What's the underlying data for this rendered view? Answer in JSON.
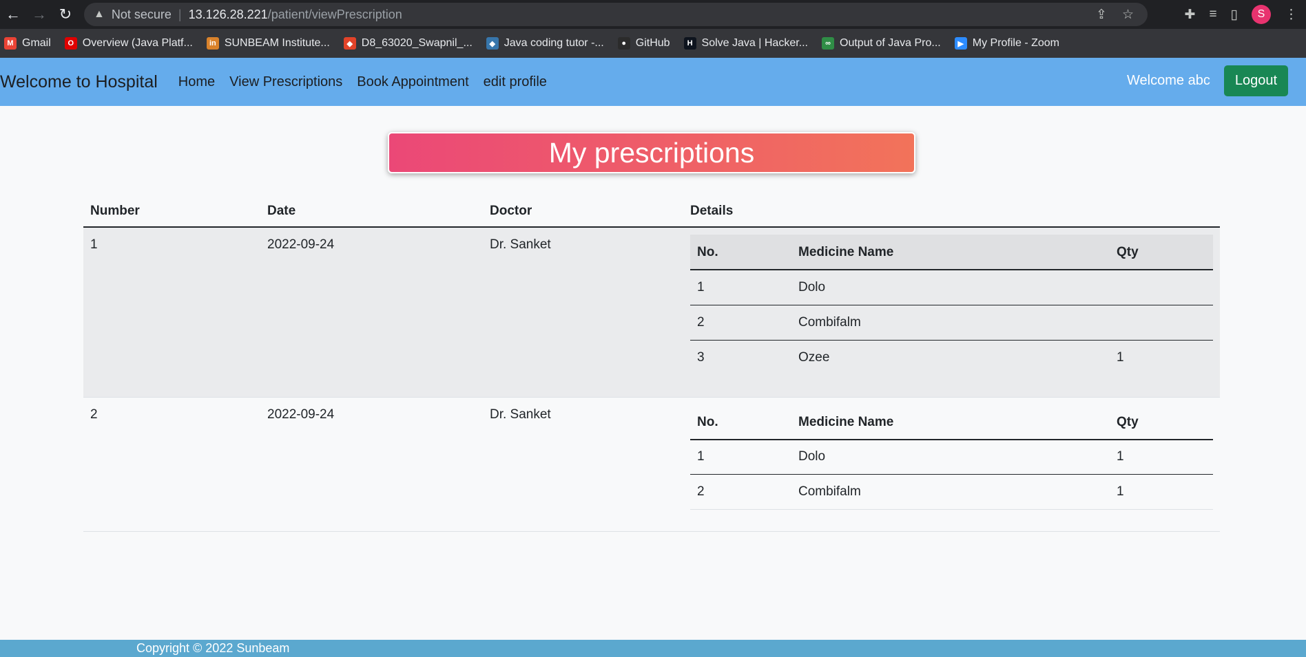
{
  "browser": {
    "security": "Not secure",
    "url_host": "13.126.28.221",
    "url_path": "/patient/viewPrescription",
    "profile_initial": "S",
    "bookmarks": [
      {
        "label": "Gmail",
        "color": "#ea4335",
        "glyph": "M"
      },
      {
        "label": "Overview (Java Platf...",
        "color": "#e00000",
        "glyph": "O"
      },
      {
        "label": "SUNBEAM Institute...",
        "color": "#d9822b",
        "glyph": "in"
      },
      {
        "label": "D8_63020_Swapnil_...",
        "color": "#e24329",
        "glyph": "◆"
      },
      {
        "label": "Java coding tutor -...",
        "color": "#3776ab",
        "glyph": "◆"
      },
      {
        "label": "GitHub",
        "color": "#2b2b2b",
        "glyph": "●"
      },
      {
        "label": "Solve Java | Hacker...",
        "color": "#0e141e",
        "glyph": "H"
      },
      {
        "label": "Output of Java Pro...",
        "color": "#2f8d46",
        "glyph": "∞"
      },
      {
        "label": "My Profile - Zoom",
        "color": "#2d8cff",
        "glyph": "▶"
      }
    ]
  },
  "navbar": {
    "brand": "Welcome to Hospital",
    "links": [
      "Home",
      "View Prescriptions",
      "Book Appointment",
      "edit profile"
    ],
    "welcome": "Welcome abc",
    "logout": "Logout"
  },
  "page": {
    "title": "My prescriptions"
  },
  "table": {
    "headers": [
      "Number",
      "Date",
      "Doctor",
      "Details"
    ],
    "inner_headers": [
      "No.",
      "Medicine Name",
      "Qty"
    ],
    "rows": [
      {
        "number": "1",
        "date": "2022-09-24",
        "doctor": "Dr. Sanket",
        "medicines": [
          {
            "no": "1",
            "name": "Dolo",
            "qty": ""
          },
          {
            "no": "2",
            "name": "Combifalm",
            "qty": ""
          },
          {
            "no": "3",
            "name": "Ozee",
            "qty": "1"
          }
        ]
      },
      {
        "number": "2",
        "date": "2022-09-24",
        "doctor": "Dr. Sanket",
        "medicines": [
          {
            "no": "1",
            "name": "Dolo",
            "qty": "1"
          },
          {
            "no": "2",
            "name": "Combifalm",
            "qty": "1"
          }
        ]
      }
    ]
  },
  "footer": {
    "copyright": "Copyright © 2022 Sunbeam"
  }
}
